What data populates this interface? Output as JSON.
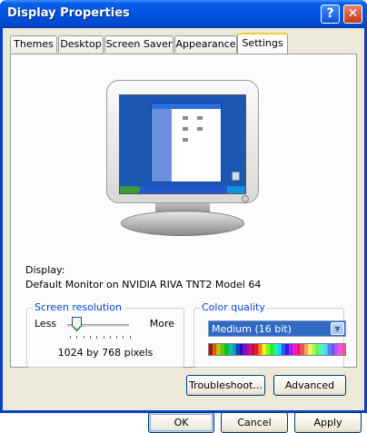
{
  "window": {
    "title": "Display Properties",
    "help_label": "?",
    "close_label": "✕"
  },
  "tabs": [
    {
      "label": "Themes"
    },
    {
      "label": "Desktop"
    },
    {
      "label": "Screen Saver"
    },
    {
      "label": "Appearance"
    },
    {
      "label": "Settings",
      "active": true
    }
  ],
  "display": {
    "label": "Display:",
    "value": "Default Monitor on NVIDIA RIVA TNT2 Model 64"
  },
  "resolution": {
    "group_title": "Screen resolution",
    "less_label": "Less",
    "more_label": "More",
    "value_text": "1024 by 768 pixels",
    "slider_level": 0.15
  },
  "color_quality": {
    "group_title": "Color quality",
    "selected": "Medium (16 bit)"
  },
  "buttons": {
    "troubleshoot": "Troubleshoot...",
    "advanced": "Advanced",
    "ok": "OK",
    "cancel": "Cancel",
    "apply": "Apply"
  },
  "colors": {
    "title_bar": "#0054e3",
    "accent": "#0046d5",
    "tab_highlight": "#ffc83c",
    "face": "#ece9d8"
  }
}
